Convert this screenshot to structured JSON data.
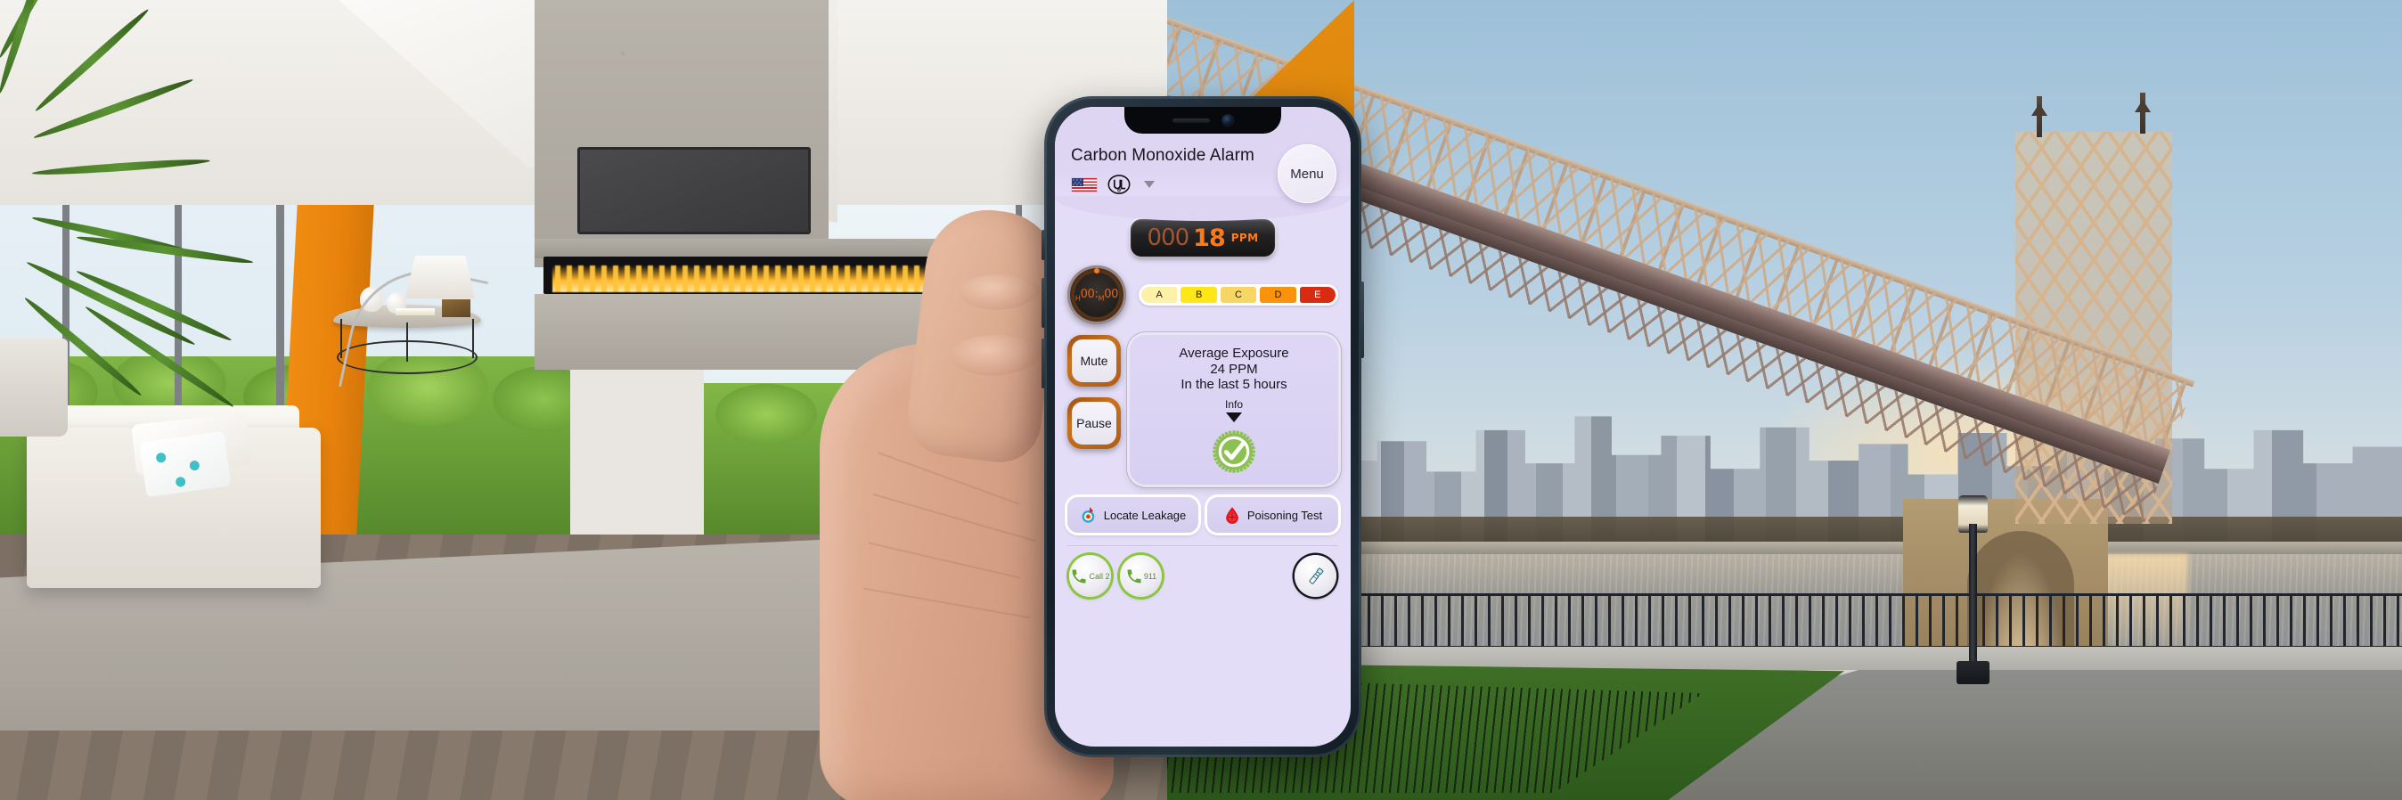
{
  "app": {
    "title": "Carbon Monoxide Alarm",
    "menu_label": "Menu",
    "cert_flag": "us-flag-icon",
    "cert_mark": "ul-certification-icon",
    "dropdown": "chevron-down-icon"
  },
  "reading": {
    "leading_zeros": "000",
    "value": "18",
    "unit": "PPM"
  },
  "timer": {
    "hours_prefix": "H",
    "hours": "00",
    "separator": ":",
    "minutes_prefix": "M",
    "minutes": "00",
    "display": "H00:M00"
  },
  "scale": {
    "segments": [
      {
        "label": "A",
        "color": "#fdf0a8"
      },
      {
        "label": "B",
        "color": "#ffe616"
      },
      {
        "label": "C",
        "color": "#f8d663"
      },
      {
        "label": "D",
        "color": "#f9930b"
      },
      {
        "label": "E",
        "color": "#d92b12"
      }
    ]
  },
  "controls": {
    "mute_label": "Mute",
    "pause_label": "Pause"
  },
  "exposure": {
    "heading": "Average Exposure",
    "value": "24 PPM",
    "period": "In the last 5 hours",
    "info_label": "Info",
    "status_icon": "green-check-badge-icon"
  },
  "actions": [
    {
      "label": "Locate Leakage",
      "icon": "target-bullseye-icon"
    },
    {
      "label": "Poisoning Test",
      "icon": "blood-drop-icon"
    }
  ],
  "bottom": {
    "calls": [
      {
        "label": "Call 2",
        "icon": "phone-icon"
      },
      {
        "label": "911",
        "icon": "phone-icon"
      }
    ],
    "flashlight_icon": "flashlight-icon"
  },
  "colors": {
    "screen_bg": "#e4ddf7",
    "header_bg": "#ded5f3",
    "accent_orange": "#ff7a15",
    "green": "#8cc63f",
    "wedge_orange": "#e78f12"
  }
}
